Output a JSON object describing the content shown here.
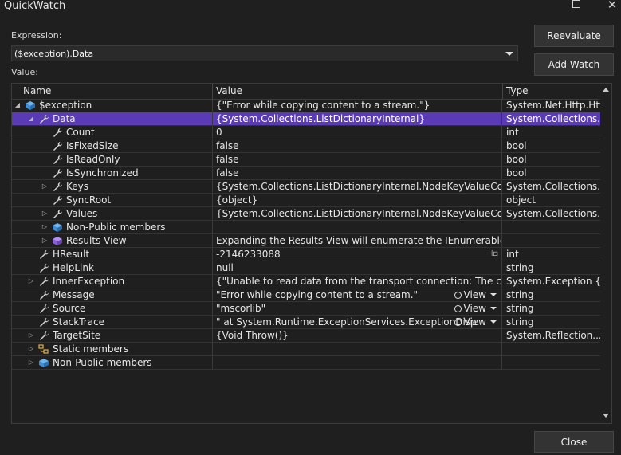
{
  "window": {
    "title": "QuickWatch"
  },
  "expression": {
    "label": "Expression:",
    "value": "($exception).Data"
  },
  "value_label": "Value:",
  "buttons": {
    "reevaluate": "Reevaluate",
    "add_watch": "Add Watch",
    "close": "Close"
  },
  "grid": {
    "columns": {
      "name": "Name",
      "value": "Value",
      "type": "Type"
    },
    "rows": [
      {
        "depth": 0,
        "expander": "expanded",
        "icon": "exception-object-icon",
        "name": "$exception",
        "value": "{\"Error while copying content to a stream.\"}",
        "type": "System.Net.Http.Htt...",
        "selected": false
      },
      {
        "depth": 1,
        "expander": "expanded",
        "icon": "property-wrench-icon",
        "name": "Data",
        "value": "{System.Collections.ListDictionaryInternal}",
        "type": "System.Collections.I...",
        "selected": true
      },
      {
        "depth": 2,
        "expander": "none",
        "icon": "property-wrench-icon",
        "name": "Count",
        "value": "0",
        "type": "int",
        "selected": false
      },
      {
        "depth": 2,
        "expander": "none",
        "icon": "property-wrench-icon",
        "name": "IsFixedSize",
        "value": "false",
        "type": "bool",
        "selected": false
      },
      {
        "depth": 2,
        "expander": "none",
        "icon": "property-wrench-icon",
        "name": "IsReadOnly",
        "value": "false",
        "type": "bool",
        "selected": false
      },
      {
        "depth": 2,
        "expander": "none",
        "icon": "property-wrench-icon",
        "name": "IsSynchronized",
        "value": "false",
        "type": "bool",
        "selected": false
      },
      {
        "depth": 2,
        "expander": "collapsed",
        "icon": "property-wrench-icon",
        "name": "Keys",
        "value": "{System.Collections.ListDictionaryInternal.NodeKeyValueCollection}",
        "type": "System.Collections.I...",
        "selected": false
      },
      {
        "depth": 2,
        "expander": "none",
        "icon": "property-wrench-icon",
        "name": "SyncRoot",
        "value": "{object}",
        "type": "object",
        "selected": false
      },
      {
        "depth": 2,
        "expander": "collapsed",
        "icon": "property-wrench-icon",
        "name": "Values",
        "value": "{System.Collections.ListDictionaryInternal.NodeKeyValueCollection}",
        "type": "System.Collections.I...",
        "selected": false
      },
      {
        "depth": 2,
        "expander": "collapsed",
        "icon": "non-public-members-icon",
        "name": "Non-Public members",
        "value": "",
        "type": "",
        "selected": false
      },
      {
        "depth": 2,
        "expander": "collapsed",
        "icon": "results-view-icon",
        "name": "Results View",
        "value": "Expanding the Results View will enumerate the IEnumerable",
        "type": "",
        "selected": false
      },
      {
        "depth": 1,
        "expander": "none",
        "icon": "property-wrench-icon",
        "name": "HResult",
        "value": "-2146233088",
        "type": "int",
        "selected": false,
        "pin": true
      },
      {
        "depth": 1,
        "expander": "none",
        "icon": "property-wrench-icon",
        "name": "HelpLink",
        "value": "null",
        "type": "string",
        "selected": false
      },
      {
        "depth": 1,
        "expander": "collapsed",
        "icon": "property-wrench-icon",
        "name": "InnerException",
        "value": "{\"Unable to read data from the transport connection: The connecti...",
        "type": "System.Exception {S...",
        "selected": false
      },
      {
        "depth": 1,
        "expander": "none",
        "icon": "property-wrench-icon",
        "name": "Message",
        "value": "\"Error while copying content to a stream.\"",
        "type": "string",
        "selected": false,
        "viewer": "View"
      },
      {
        "depth": 1,
        "expander": "none",
        "icon": "property-wrench-icon",
        "name": "Source",
        "value": "\"mscorlib\"",
        "type": "string",
        "selected": false,
        "viewer": "View"
      },
      {
        "depth": 1,
        "expander": "none",
        "icon": "property-wrench-icon",
        "name": "StackTrace",
        "value": "\"   at System.Runtime.ExceptionServices.ExceptionDisp...",
        "type": "string",
        "selected": false,
        "viewer": "View"
      },
      {
        "depth": 1,
        "expander": "collapsed",
        "icon": "property-wrench-icon",
        "name": "TargetSite",
        "value": "{Void Throw()}",
        "type": "System.Reflection....",
        "selected": false
      },
      {
        "depth": 1,
        "expander": "collapsed",
        "icon": "static-members-icon",
        "name": "Static members",
        "value": "",
        "type": "",
        "selected": false
      },
      {
        "depth": 1,
        "expander": "collapsed",
        "icon": "non-public-members-icon",
        "name": "Non-Public members",
        "value": "",
        "type": "",
        "selected": false
      }
    ]
  },
  "colors": {
    "selection": "#5b3bb5",
    "background": "#1f1f1f"
  }
}
